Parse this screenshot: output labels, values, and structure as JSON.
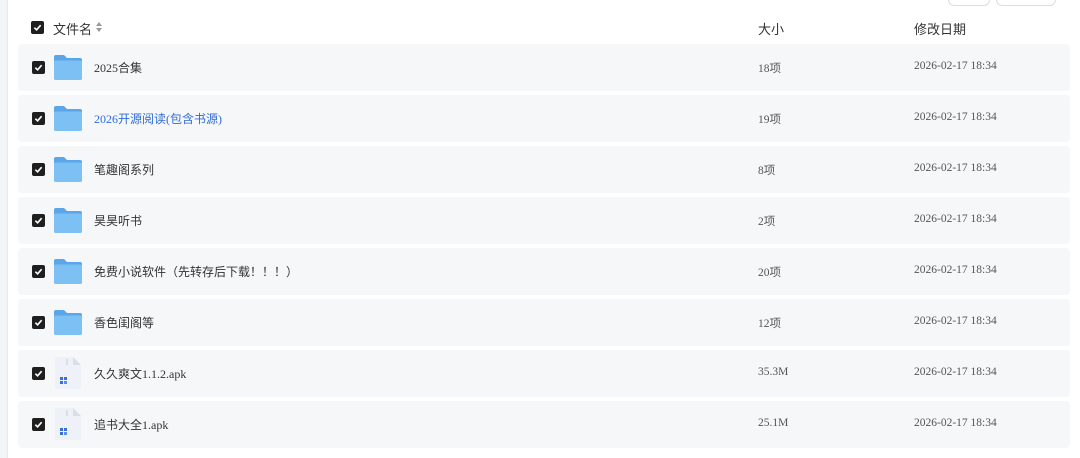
{
  "header": {
    "name_label": "文件名",
    "size_label": "大小",
    "date_label": "修改日期"
  },
  "files": [
    {
      "name": "2025合集",
      "size": "18项",
      "date": "2026-02-17 18:34",
      "type": "folder",
      "checked": true
    },
    {
      "name": "2026开源阅读(包含书源)",
      "size": "19项",
      "date": "2026-02-17 18:34",
      "type": "folder",
      "checked": true,
      "highlighted": true
    },
    {
      "name": "笔趣阁系列",
      "size": "8项",
      "date": "2026-02-17 18:34",
      "type": "folder",
      "checked": true
    },
    {
      "name": "昊昊听书",
      "size": "2项",
      "date": "2026-02-17 18:34",
      "type": "folder",
      "checked": true
    },
    {
      "name": "免费小说软件（先转存后下载！！！）",
      "size": "20项",
      "date": "2026-02-17 18:34",
      "type": "folder",
      "checked": true
    },
    {
      "name": "香色闺阁等",
      "size": "12项",
      "date": "2026-02-17 18:34",
      "type": "folder",
      "checked": true
    },
    {
      "name": "久久爽文1.1.2.apk",
      "size": "35.3M",
      "date": "2026-02-17 18:34",
      "type": "apk",
      "checked": true
    },
    {
      "name": "追书大全1.apk",
      "size": "25.1M",
      "date": "2026-02-17 18:34",
      "type": "apk",
      "checked": true
    }
  ],
  "colors": {
    "row_bg": "#f6f7f9",
    "link": "#2f6bd8",
    "folder": "#6bb3ee",
    "checkbox": "#1f1f1f"
  }
}
